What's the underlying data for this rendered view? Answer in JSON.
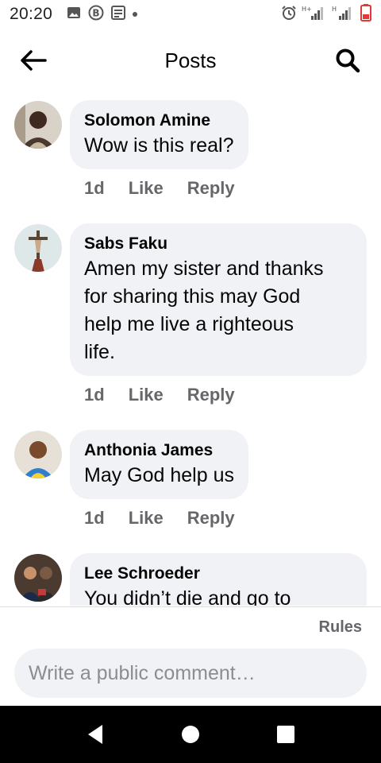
{
  "status_bar": {
    "time": "20:20",
    "left_icons": [
      "image-icon",
      "b-icon",
      "news-icon",
      "dot-icon"
    ],
    "right_icons": [
      "alarm-icon",
      "signal-hplus-icon",
      "signal-h-icon",
      "battery-low-icon"
    ],
    "battery_color": "#e53935"
  },
  "header": {
    "title": "Posts"
  },
  "comments": [
    {
      "author": "Solomon Amine",
      "text": "Wow is this real?",
      "time": "1d",
      "like_label": "Like",
      "reply_label": "Reply"
    },
    {
      "author": "Sabs Faku",
      "text_lines": [
        "Amen my sister and thanks",
        "for sharing this may God",
        "help me live a righteous",
        "life."
      ],
      "time": "1d",
      "like_label": "Like",
      "reply_label": "Reply"
    },
    {
      "author": "Anthonia James",
      "text": "May God help us",
      "time": "1d",
      "like_label": "Like",
      "reply_label": "Reply"
    },
    {
      "author": "Lee Schroeder",
      "text": "You didn’t die and go to"
    }
  ],
  "footer": {
    "rules_label": "Rules",
    "composer_placeholder": "Write a public comment…"
  },
  "colors": {
    "bubble_bg": "#f0f2f5",
    "secondary_text": "#65676b",
    "navbar_bg": "#000000"
  }
}
